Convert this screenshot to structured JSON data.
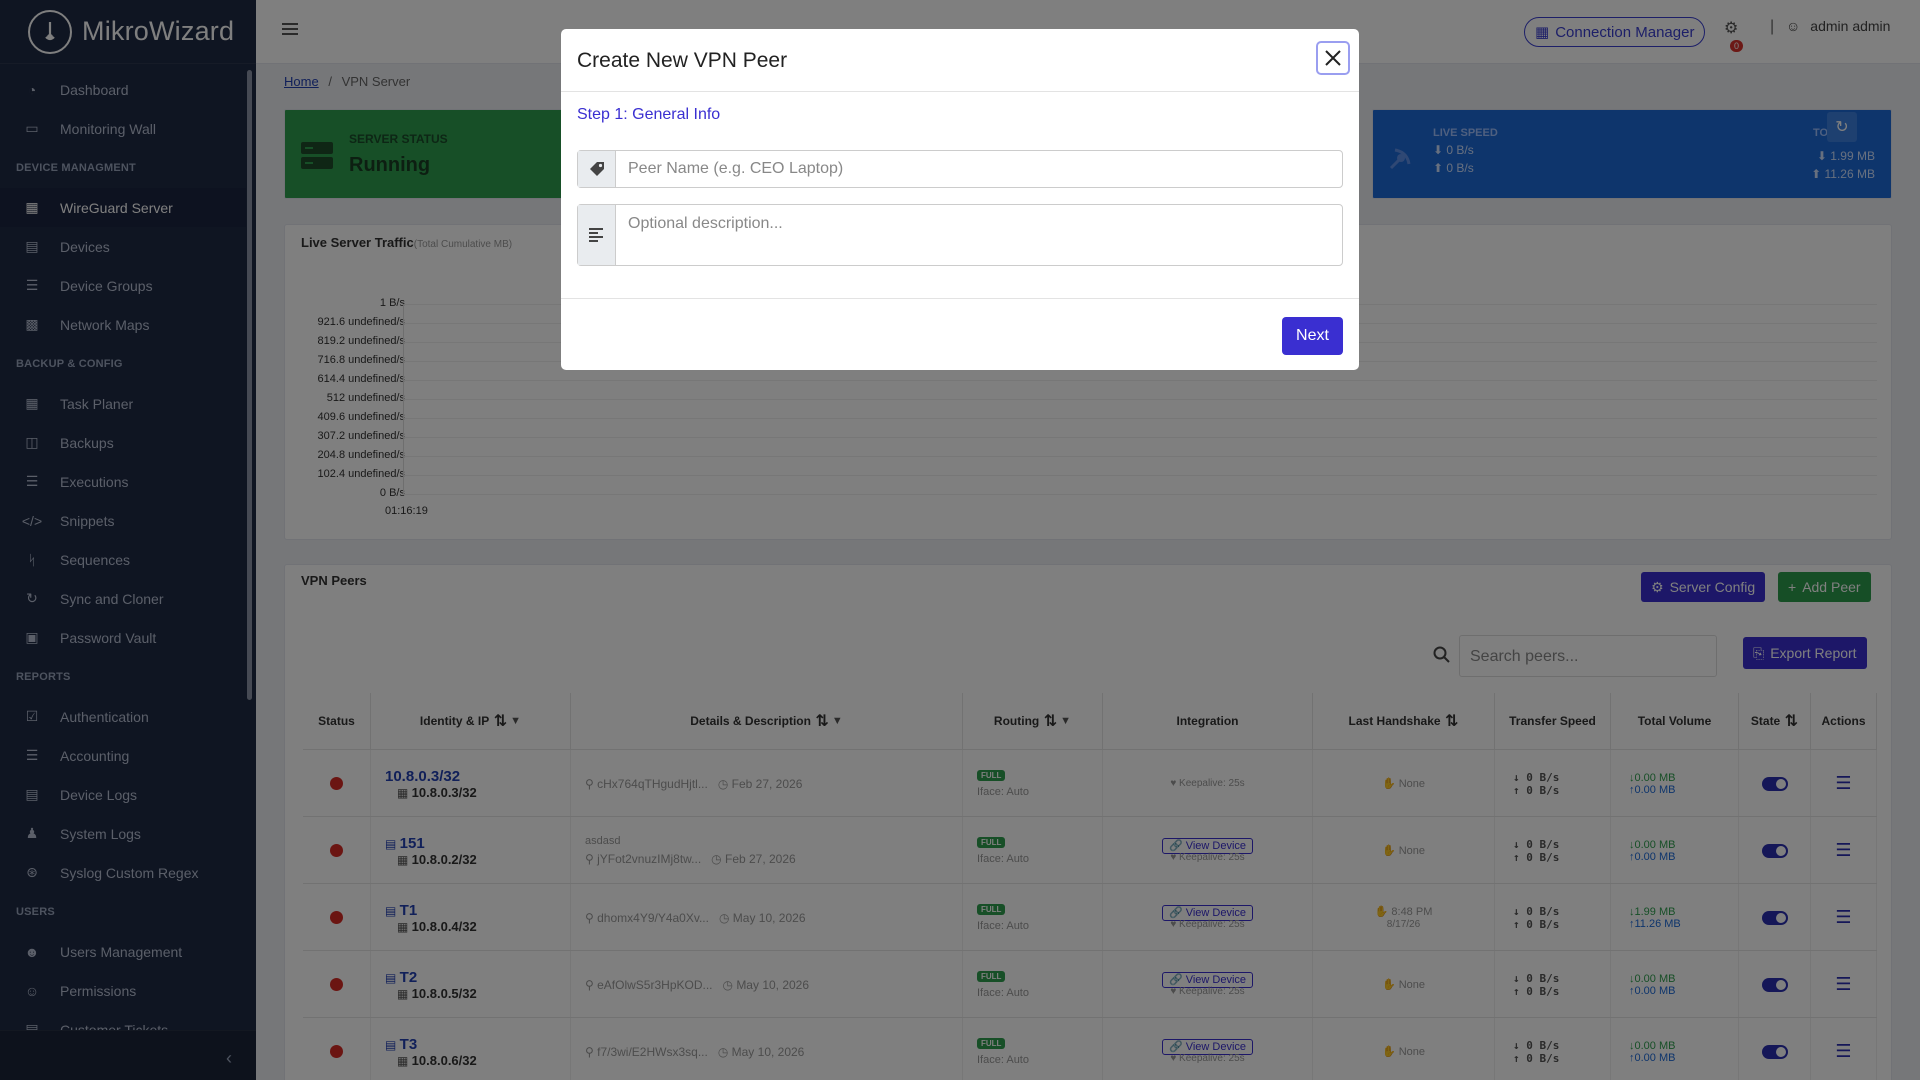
{
  "app": {
    "name": "MikroWizard"
  },
  "sidebar": {
    "items": [
      {
        "label": "Dashboard",
        "icon": "dashboard-icon"
      },
      {
        "label": "Monitoring Wall",
        "icon": "monitor-icon"
      },
      {
        "section": "DEVICE MANAGMENT"
      },
      {
        "label": "WireGuard Server",
        "icon": "network-icon",
        "active": true
      },
      {
        "label": "Devices",
        "icon": "server-icon"
      },
      {
        "label": "Device Groups",
        "icon": "layers-icon"
      },
      {
        "label": "Network Maps",
        "icon": "map-icon"
      },
      {
        "section": "BACKUP & CONFIG"
      },
      {
        "label": "Task Planer",
        "icon": "calendar-icon"
      },
      {
        "label": "Backups",
        "icon": "database-icon"
      },
      {
        "label": "Executions",
        "icon": "list-icon"
      },
      {
        "label": "Snippets",
        "icon": "code-icon"
      },
      {
        "label": "Sequences",
        "icon": "branch-icon"
      },
      {
        "label": "Sync and Cloner",
        "icon": "sync-icon"
      },
      {
        "label": "Password Vault",
        "icon": "vault-icon"
      },
      {
        "section": "REPORTS"
      },
      {
        "label": "Authentication",
        "icon": "chart-check-icon"
      },
      {
        "label": "Accounting",
        "icon": "list-icon"
      },
      {
        "label": "Device Logs",
        "icon": "log-icon"
      },
      {
        "label": "System Logs",
        "icon": "person-log-icon"
      },
      {
        "label": "Syslog Custom Regex",
        "icon": "regex-icon"
      },
      {
        "section": "USERS"
      },
      {
        "label": "Users Management",
        "icon": "user-gear-icon"
      },
      {
        "label": "Permissions",
        "icon": "users-icon"
      },
      {
        "label": "Customer Tickets",
        "icon": "ticket-icon"
      }
    ]
  },
  "topbar": {
    "connection_manager": "Connection Manager",
    "notification_count": "0",
    "user": "admin admin"
  },
  "breadcrumb": {
    "home": "Home",
    "sep": "/",
    "current": "VPN Server"
  },
  "server_status": {
    "label": "SERVER STATUS",
    "value": "Running"
  },
  "live_speed": {
    "label": "LIVE SPEED",
    "down": "0 B/s",
    "up": "0 B/s",
    "total_label": "TOTAL",
    "total_down": "1.99 MB",
    "total_up": "11.26 MB"
  },
  "traffic": {
    "title": "Live Server Traffic",
    "subtitle": "(Total Cumulative MB)",
    "y_ticks": [
      "1 B/s",
      "921.6 undefined/s",
      "819.2 undefined/s",
      "716.8 undefined/s",
      "614.4 undefined/s",
      "512 undefined/s",
      "409.6 undefined/s",
      "307.2 undefined/s",
      "204.8 undefined/s",
      "102.4 undefined/s",
      "0 B/s"
    ],
    "x_tick": "01:16:19"
  },
  "peers": {
    "title": "VPN Peers",
    "server_config": "Server Config",
    "add_peer": "Add Peer",
    "search_placeholder": "Search peers...",
    "export": "Export Report",
    "columns": [
      "Status",
      "Identity & IP",
      "Details & Description",
      "Routing",
      "Integration",
      "Last Handshake",
      "Transfer Speed",
      "Total Volume",
      "State",
      "Actions"
    ],
    "rows": [
      {
        "name": "10.8.0.3/32",
        "ip": "10.8.0.3/32",
        "desc": "",
        "key": "cHx764qTHgudHjtl...",
        "date": "Feb 27, 2026",
        "routing": "FULL",
        "iface": "Iface: Auto",
        "view": "",
        "keepalive": "Keepalive: 25s",
        "handshake": "None",
        "handshake_date": "",
        "speed_down": "0 B/s",
        "speed_up": "0 B/s",
        "vol_down": "0.00 MB",
        "vol_up": "0.00 MB"
      },
      {
        "name": "151",
        "ip": "10.8.0.2/32",
        "desc": "asdasd",
        "key": "jYFot2vnuzIMj8tw...",
        "date": "Feb 27, 2026",
        "routing": "FULL",
        "iface": "Iface: Auto",
        "view": "View Device",
        "keepalive": "Keepalive: 25s",
        "handshake": "None",
        "handshake_date": "",
        "speed_down": "0 B/s",
        "speed_up": "0 B/s",
        "vol_down": "0.00 MB",
        "vol_up": "0.00 MB"
      },
      {
        "name": "T1",
        "ip": "10.8.0.4/32",
        "desc": "",
        "key": "dhomx4Y9/Y4a0Xv...",
        "date": "May 10, 2026",
        "routing": "FULL",
        "iface": "Iface: Auto",
        "view": "View Device",
        "keepalive": "Keepalive: 25s",
        "handshake": "8:48 PM",
        "handshake_date": "8/17/26",
        "speed_down": "0 B/s",
        "speed_up": "0 B/s",
        "vol_down": "1.99 MB",
        "vol_up": "11.26 MB"
      },
      {
        "name": "T2",
        "ip": "10.8.0.5/32",
        "desc": "",
        "key": "eAfOlwS5r3HpKOD...",
        "date": "May 10, 2026",
        "routing": "FULL",
        "iface": "Iface: Auto",
        "view": "View Device",
        "keepalive": "Keepalive: 25s",
        "handshake": "None",
        "handshake_date": "",
        "speed_down": "0 B/s",
        "speed_up": "0 B/s",
        "vol_down": "0.00 MB",
        "vol_up": "0.00 MB"
      },
      {
        "name": "T3",
        "ip": "10.8.0.6/32",
        "desc": "",
        "key": "f7/3wi/E2HWsx3sq...",
        "date": "May 10, 2026",
        "routing": "FULL",
        "iface": "Iface: Auto",
        "view": "View Device",
        "keepalive": "Keepalive: 25s",
        "handshake": "None",
        "handshake_date": "",
        "speed_down": "0 B/s",
        "speed_up": "0 B/s",
        "vol_down": "0.00 MB",
        "vol_up": "0.00 MB"
      }
    ]
  },
  "modal": {
    "title": "Create New VPN Peer",
    "step": "Step 1: General Info",
    "name_placeholder": "Peer Name (e.g. CEO Laptop)",
    "desc_placeholder": "Optional description...",
    "next": "Next"
  },
  "colors": {
    "sidebar_bg": "#1f2a44",
    "accent": "#3a2fd1",
    "success": "#2f9f4e",
    "info": "#1d6ad9",
    "danger": "#d62b25"
  }
}
